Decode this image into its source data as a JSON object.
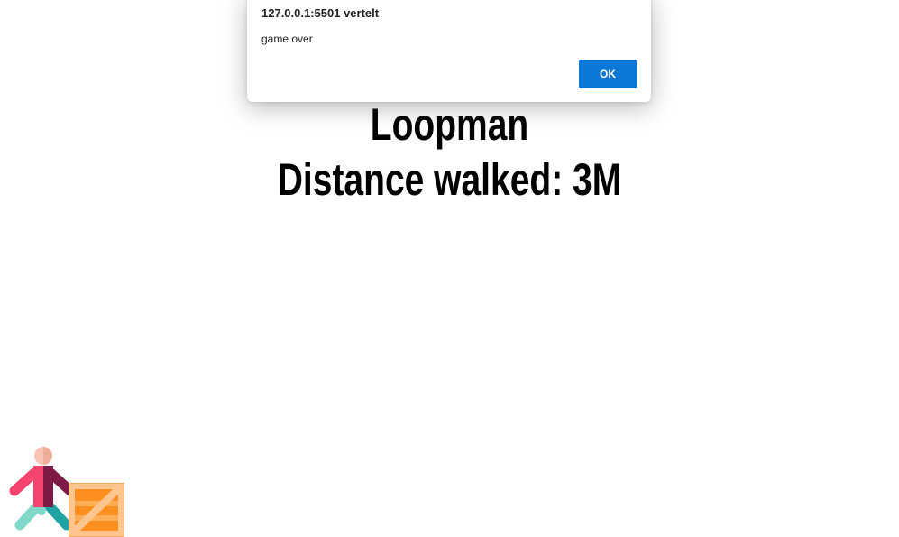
{
  "alert": {
    "origin": "127.0.0.1:5501 vertelt",
    "message": "game over",
    "ok_label": "OK"
  },
  "game": {
    "title": "Loopman",
    "distance_label": "Distance walked:",
    "distance_value": "3M"
  },
  "sprites": {
    "player_icon": "walking-man-icon",
    "obstacle_icon": "wooden-crate-icon"
  },
  "colors": {
    "alert_button": "#0b78d7",
    "player_head": "#f7c3b5",
    "player_torso_left": "#f5446e",
    "player_torso_right": "#7d1a45",
    "player_legs": "#7fd8c8",
    "player_legs_dark": "#1fa3a3",
    "crate_frame": "#ffc58f",
    "crate_fill": "#ff8f1f"
  }
}
